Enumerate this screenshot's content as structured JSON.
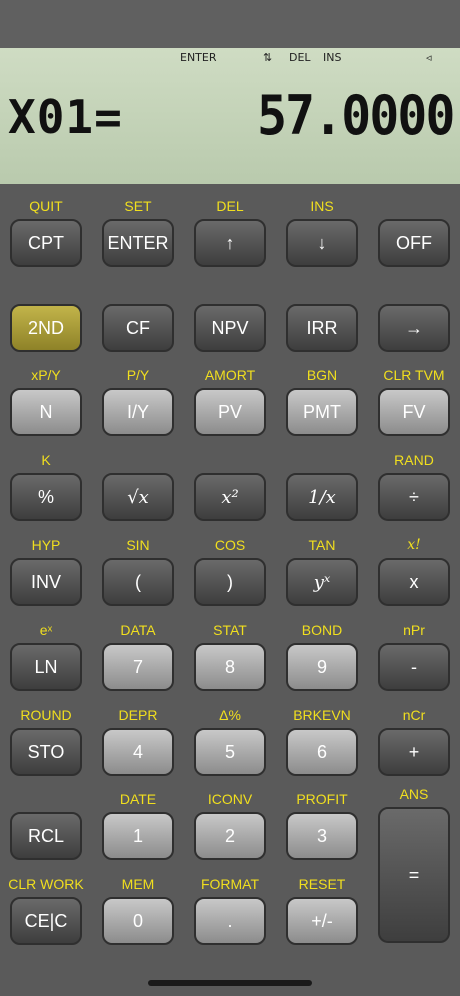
{
  "display": {
    "annunciators": {
      "enter": "ENTER",
      "updown": "⇅",
      "del": "DEL",
      "ins": "INS",
      "arrow": "◃"
    },
    "variable": "X01=",
    "value": "57.0000"
  },
  "rows": [
    {
      "labels": [
        "QUIT",
        "SET",
        "DEL",
        "INS",
        ""
      ],
      "keys": [
        "CPT",
        "ENTER",
        "↑",
        "↓",
        "OFF"
      ]
    },
    {
      "labels": [
        "",
        "",
        "",
        "",
        ""
      ],
      "keys": [
        "2ND",
        "CF",
        "NPV",
        "IRR",
        "→"
      ]
    },
    {
      "labels": [
        "xP/Y",
        "P/Y",
        "AMORT",
        "BGN",
        "CLR TVM"
      ],
      "keys": [
        "N",
        "I/Y",
        "PV",
        "PMT",
        "FV"
      ]
    },
    {
      "labels": [
        "K",
        "",
        "",
        "",
        "RAND"
      ],
      "keys": [
        "%",
        "√x",
        "x²",
        "1/x",
        "÷"
      ]
    },
    {
      "labels": [
        "HYP",
        "SIN",
        "COS",
        "TAN",
        "x!"
      ],
      "keys": [
        "INV",
        "(",
        ")",
        "yˣ",
        "x"
      ]
    },
    {
      "labels": [
        "eˣ",
        "DATA",
        "STAT",
        "BOND",
        "nPr"
      ],
      "keys": [
        "LN",
        "7",
        "8",
        "9",
        "-"
      ]
    },
    {
      "labels": [
        "ROUND",
        "DEPR",
        "Δ%",
        "BRKEVN",
        "nCr"
      ],
      "keys": [
        "STO",
        "4",
        "5",
        "6",
        "+"
      ]
    },
    {
      "labels": [
        "",
        "DATE",
        "ICONV",
        "PROFIT",
        "ANS"
      ],
      "keys": [
        "RCL",
        "1",
        "2",
        "3",
        "="
      ]
    },
    {
      "labels": [
        "CLR WORK",
        "MEM",
        "FORMAT",
        "RESET",
        ""
      ],
      "keys": [
        "CE|C",
        "0",
        ".",
        "+/-",
        ""
      ]
    }
  ]
}
